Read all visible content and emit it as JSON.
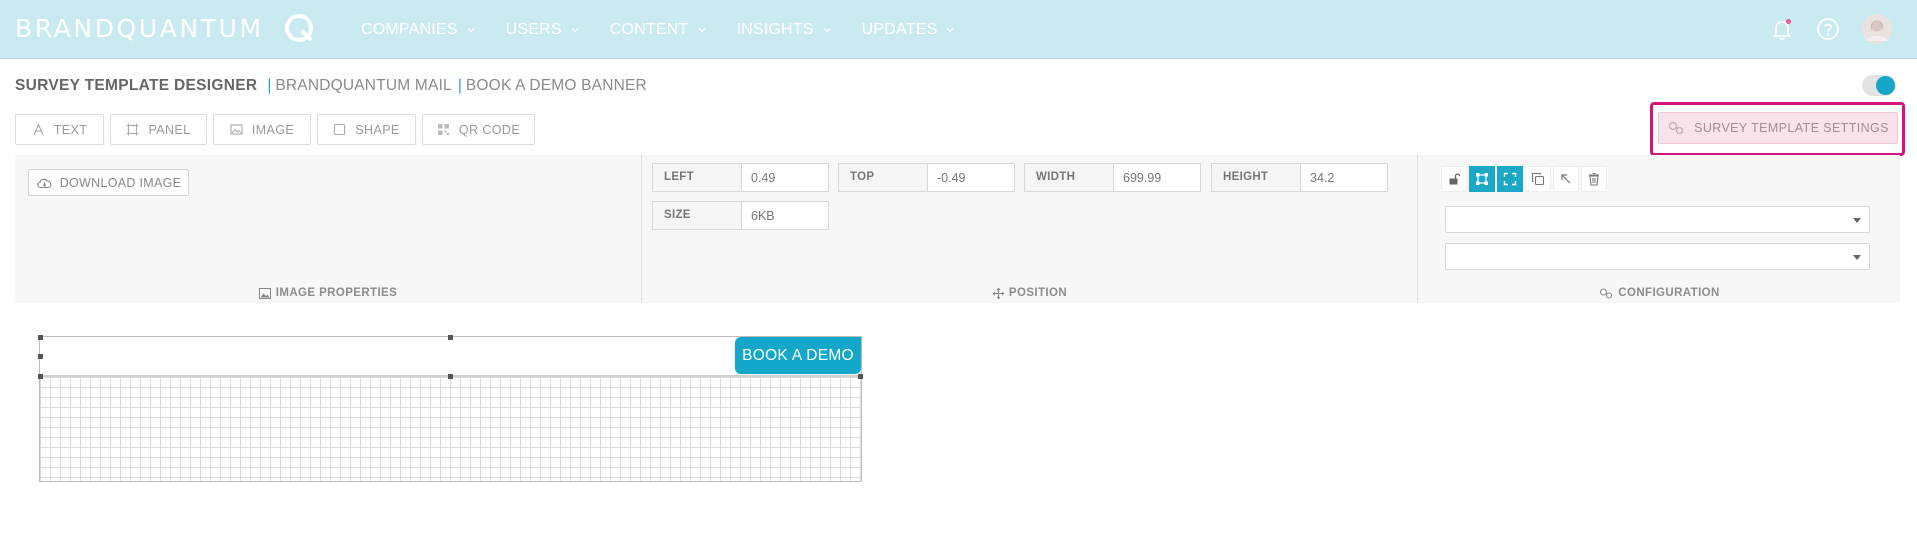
{
  "brand": {
    "name": "BRANDQUANTUM"
  },
  "nav": {
    "items": [
      {
        "label": "COMPANIES"
      },
      {
        "label": "USERS"
      },
      {
        "label": "CONTENT"
      },
      {
        "label": "INSIGHTS"
      },
      {
        "label": "UPDATES"
      }
    ]
  },
  "header": {
    "title": "SURVEY TEMPLATE DESIGNER",
    "separator": "|",
    "crumb1": "BRANDQUANTUM MAIL",
    "crumb2": "BOOK A DEMO BANNER"
  },
  "tools": {
    "text": "TEXT",
    "panel": "PANEL",
    "image": "IMAGE",
    "shape": "SHAPE",
    "qr": "QR CODE",
    "settings": "SURVEY TEMPLATE SETTINGS"
  },
  "image_properties": {
    "download_label": "DOWNLOAD IMAGE",
    "title": "IMAGE PROPERTIES"
  },
  "position": {
    "title": "POSITION",
    "left_label": "LEFT",
    "left_value": "0.49",
    "top_label": "TOP",
    "top_value": "-0.49",
    "width_label": "WIDTH",
    "width_value": "699.99",
    "height_label": "HEIGHT",
    "height_value": "34.2",
    "size_label": "SIZE",
    "size_value": "6KB"
  },
  "configuration": {
    "title": "CONFIGURATION",
    "select1_value": "",
    "select2_value": ""
  },
  "canvas": {
    "button_label": "BOOK A DEMO"
  },
  "colors": {
    "topbar": "#c9eaf0",
    "accent": "#13a7c9",
    "highlight": "#d6157c"
  }
}
